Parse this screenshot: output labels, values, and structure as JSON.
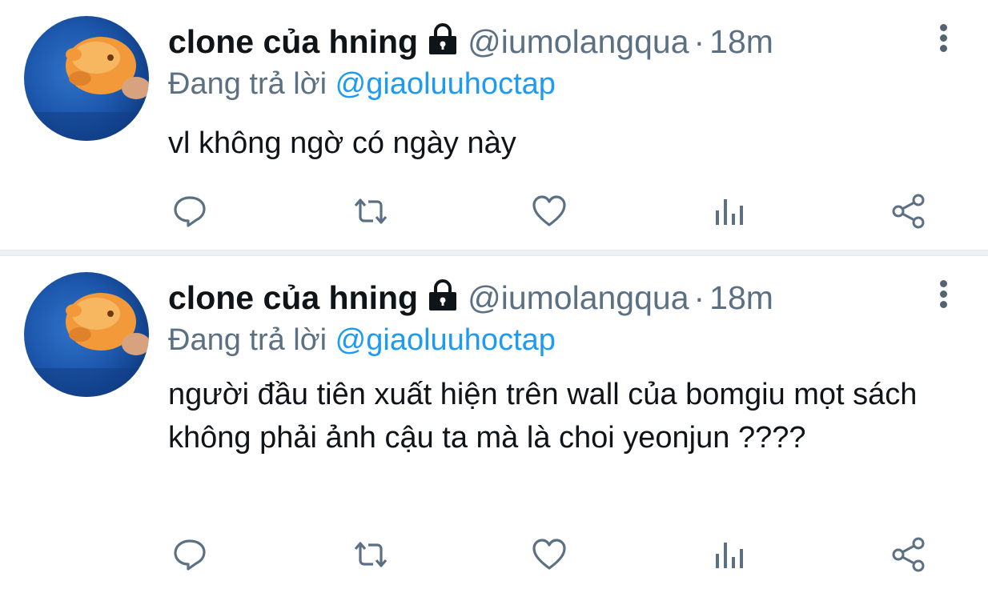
{
  "colors": {
    "name": "#0f1419",
    "muted": "#5b7083",
    "mention": "#1d9bf0",
    "divider": "#eef1f3"
  },
  "tweets": [
    {
      "display_name": "clone của hning",
      "handle": "@iumolangqua",
      "separator": "·",
      "time": "18m",
      "reply_prefix": "Đang trả lời",
      "reply_to": "@giaoluuhoctap",
      "text": "vl không ngờ có ngày này",
      "icons": [
        "reply-icon",
        "retweet-icon",
        "like-icon",
        "analytics-icon",
        "share-icon"
      ]
    },
    {
      "display_name": "clone của hning",
      "handle": "@iumolangqua",
      "separator": "·",
      "time": "18m",
      "reply_prefix": "Đang trả lời",
      "reply_to": "@giaoluuhoctap",
      "text": "người đầu tiên xuất hiện trên wall của bomgiu mọt sách không phải ảnh cậu ta mà là choi yeonjun ????",
      "icons": [
        "reply-icon",
        "retweet-icon",
        "like-icon",
        "analytics-icon",
        "share-icon"
      ]
    }
  ]
}
